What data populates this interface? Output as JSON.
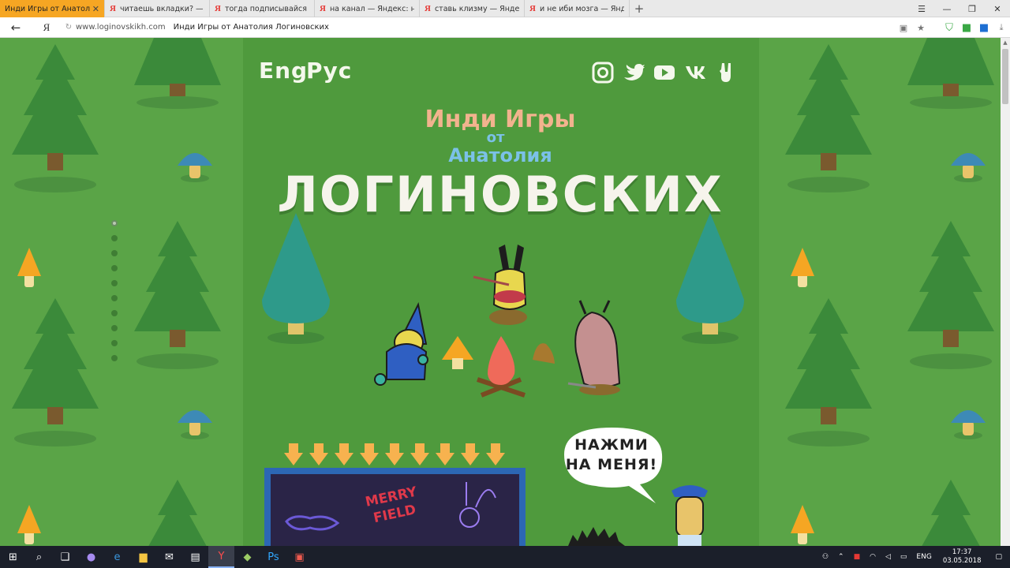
{
  "browser": {
    "tabs": [
      {
        "label": "Инди Игры от Анатолия",
        "active": true
      },
      {
        "label": "читаешь вкладки? — Яндекс",
        "active": false
      },
      {
        "label": "тогда подписывайся — Янд",
        "active": false
      },
      {
        "label": "на канал — Яндекс: нашёлс",
        "active": false
      },
      {
        "label": "ставь клизму — Яндекс: на",
        "active": false
      },
      {
        "label": "и не иби мозга — Яндекс: н",
        "active": false
      }
    ],
    "new_tab": "+",
    "yandex_letter": "Я",
    "url": "www.loginovskikh.com",
    "page_title": "Инди Игры от Анатолия Логиновских"
  },
  "site": {
    "lang_eng": "Eng",
    "lang_rus": "Рус",
    "title_line1": "Инди Игры",
    "title_line2": "от",
    "title_line3": "Анатолия",
    "title_line4": "ЛОГИНОВСКИХ",
    "bubble_line1": "НАЖМИ",
    "bubble_line2": "НА МЕНЯ!",
    "board_text": "MERRY FIELD",
    "social": [
      "instagram-icon",
      "twitter-icon",
      "youtube-icon",
      "vk-icon",
      "rock-hand-icon"
    ]
  },
  "taskbar": {
    "lang": "ENG",
    "time": "17:37",
    "date": "03.05.2018"
  },
  "colors": {
    "grass": "#5aa447",
    "center": "#4f9a3d",
    "pine": "#3b8a3a",
    "teal_tree": "#2e9a8a",
    "title_pink": "#f2b38e",
    "title_blue": "#7bc1e8",
    "board_blue": "#2c67b4",
    "tab_active": "#f6a623"
  }
}
